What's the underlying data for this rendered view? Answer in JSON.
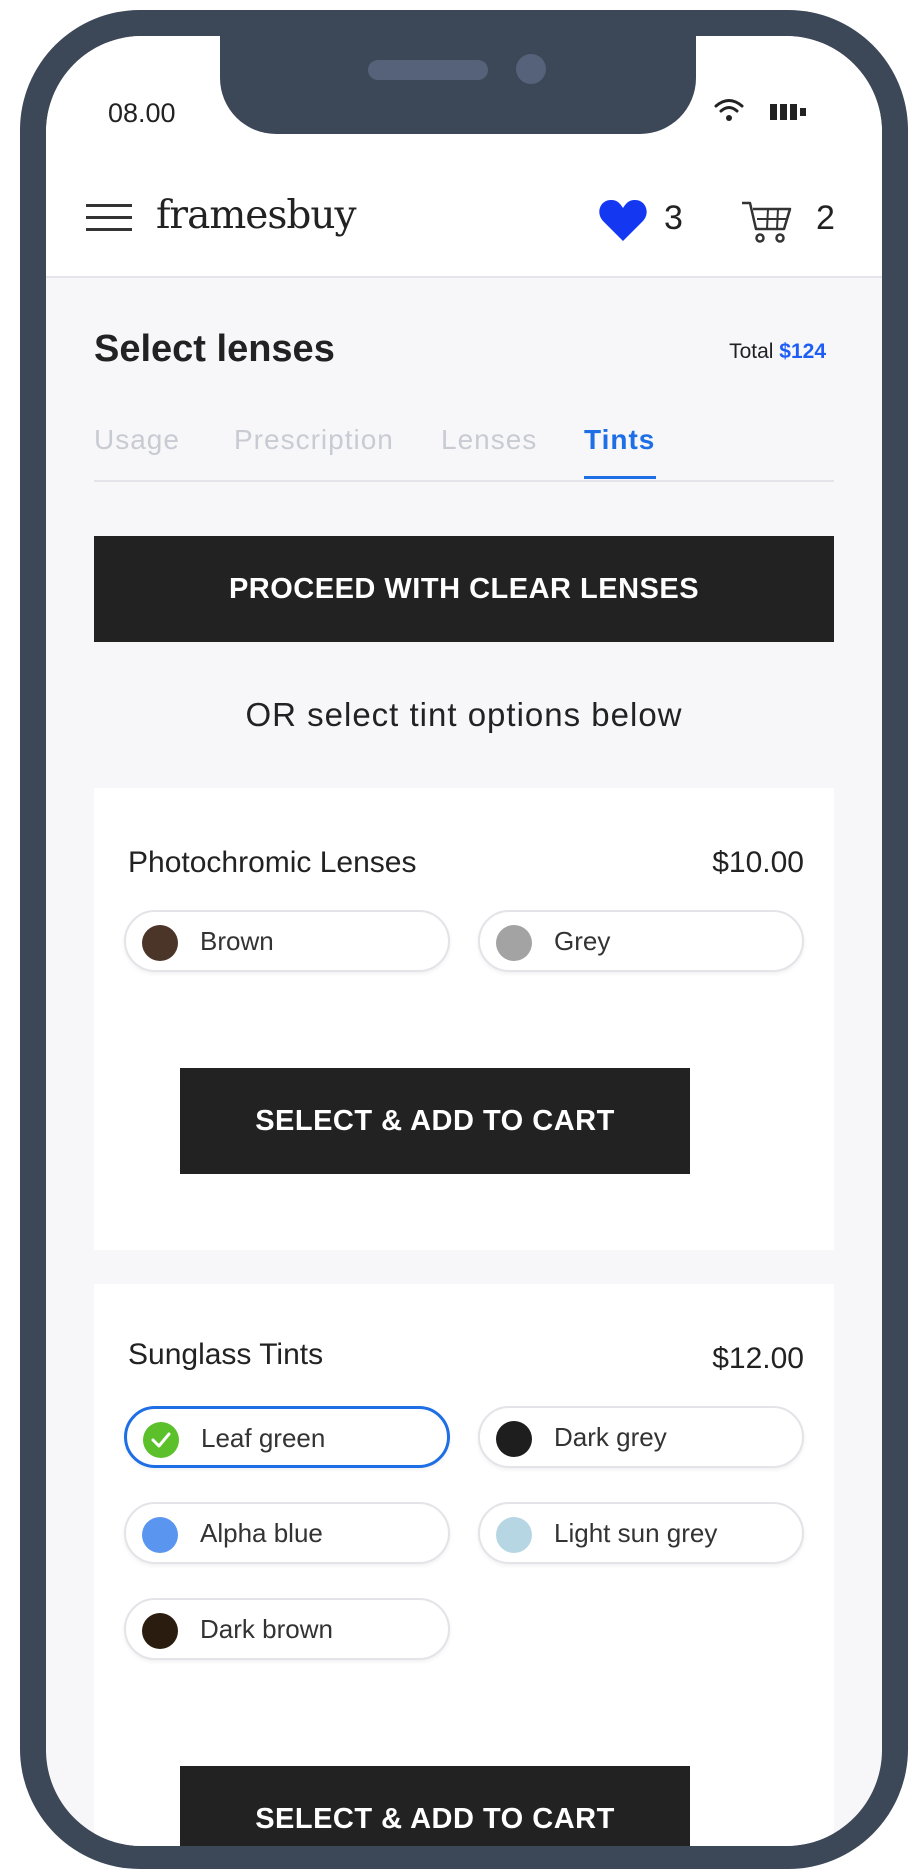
{
  "status_bar": {
    "time": "08.00"
  },
  "header": {
    "logo": "framesbuy",
    "wishlist_count": "3",
    "cart_count": "2"
  },
  "page": {
    "title": "Select lenses",
    "total_label": "Total",
    "total_value": "$124"
  },
  "tabs": [
    {
      "label": "Usage",
      "active": false
    },
    {
      "label": "Prescription",
      "active": false
    },
    {
      "label": "Lenses",
      "active": false
    },
    {
      "label": "Tints",
      "active": true
    }
  ],
  "proceed_button": "PROCEED WITH CLEAR LENSES",
  "or_text": "OR select tint options below",
  "photochromic": {
    "title": "Photochromic Lenses",
    "price": "$10.00",
    "options": [
      {
        "label": "Brown",
        "color": "#4a3528",
        "selected": false
      },
      {
        "label": "Grey",
        "color": "#a3a3a3",
        "selected": false
      }
    ],
    "button": "SELECT & ADD TO CART"
  },
  "sunglass": {
    "title": "Sunglass Tints",
    "price": "$12.00",
    "options": [
      {
        "label": "Leaf green",
        "color": "#5cc02a",
        "selected": true
      },
      {
        "label": "Dark grey",
        "color": "#1e1e1e",
        "selected": false
      },
      {
        "label": "Alpha blue",
        "color": "#5a95ef",
        "selected": false
      },
      {
        "label": "Light sun grey",
        "color": "#b7d6e4",
        "selected": false
      },
      {
        "label": "Dark brown",
        "color": "#2a1d10",
        "selected": false
      }
    ],
    "button": "SELECT & ADD TO CART"
  },
  "colors": {
    "accent": "#1e6ee6",
    "price_accent": "#1e5ef5",
    "button": "#222222",
    "phone_frame": "#3c4757"
  }
}
